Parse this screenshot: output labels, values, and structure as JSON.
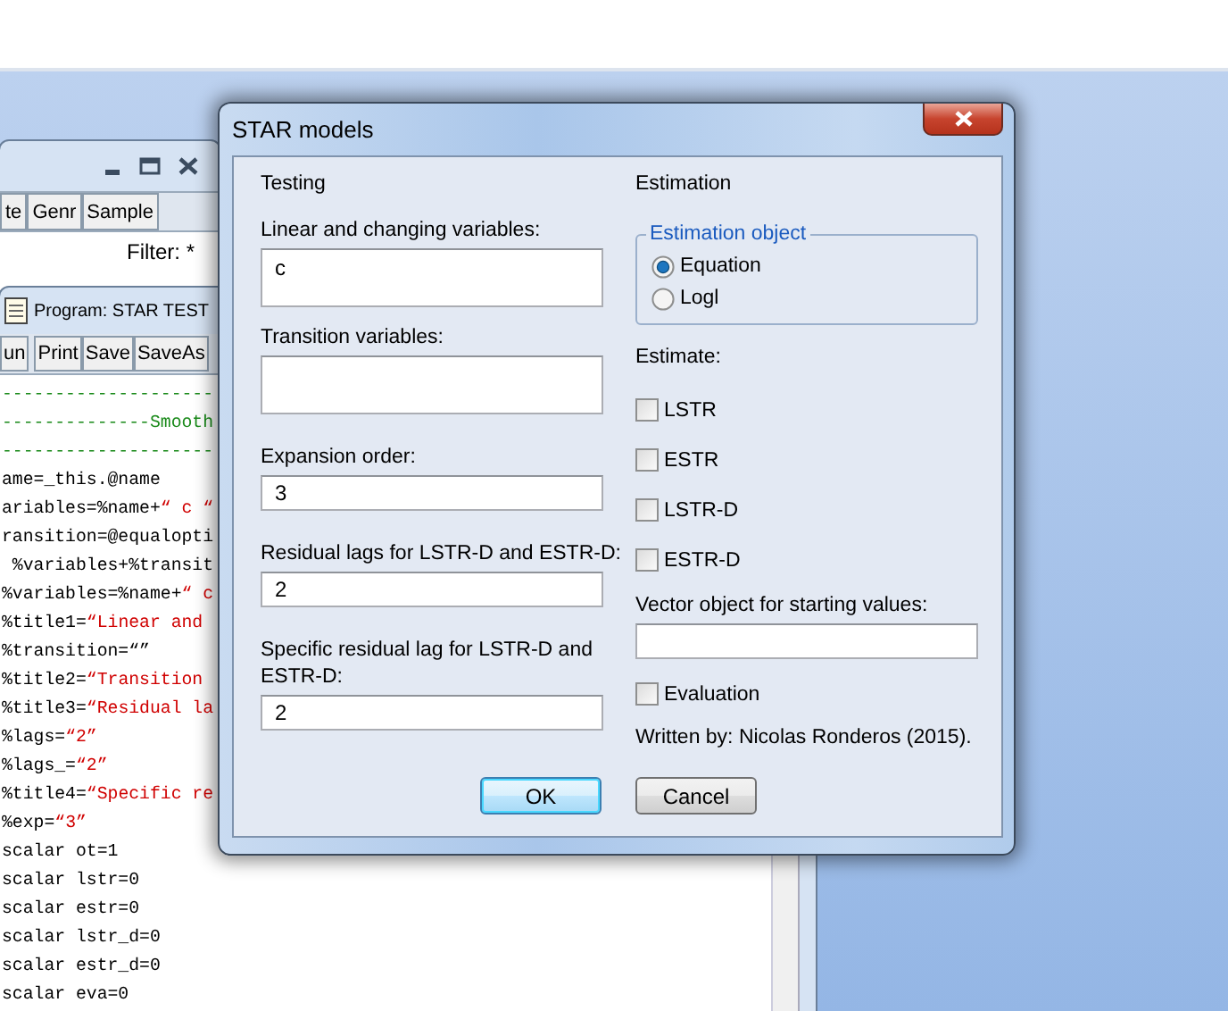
{
  "workfile": {
    "toolbar": [
      "te",
      "Genr",
      "Sample"
    ],
    "filter": "Filter: *"
  },
  "program": {
    "title": "Program: STAR TEST",
    "toolbar": [
      "un",
      "Print",
      "Save",
      "SaveAs"
    ],
    "lines": [
      {
        "parts": [
          {
            "kind": "comment",
            "text": "--------------------"
          }
        ]
      },
      {
        "parts": [
          {
            "kind": "comment",
            "text": "--------------Smooth"
          }
        ]
      },
      {
        "parts": [
          {
            "kind": "comment",
            "text": "--------------------"
          }
        ]
      },
      {
        "parts": [
          {
            "kind": "code",
            "text": "ame=_this.@name"
          }
        ]
      },
      {
        "parts": [
          {
            "kind": "code",
            "text": "ariables=%name+"
          },
          {
            "kind": "string",
            "text": "“ c “"
          }
        ]
      },
      {
        "parts": [
          {
            "kind": "code",
            "text": "ransition=@equalopti"
          }
        ]
      },
      {
        "parts": [
          {
            "kind": "code",
            "text": " %variables+%transit"
          }
        ]
      },
      {
        "parts": [
          {
            "kind": "code",
            "text": "%variables=%name+"
          },
          {
            "kind": "string",
            "text": "“ c"
          }
        ]
      },
      {
        "parts": [
          {
            "kind": "code",
            "text": "%title1="
          },
          {
            "kind": "string",
            "text": "“Linear and"
          }
        ]
      },
      {
        "parts": [
          {
            "kind": "code",
            "text": "%transition=“”"
          }
        ]
      },
      {
        "parts": [
          {
            "kind": "code",
            "text": "%title2="
          },
          {
            "kind": "string",
            "text": "“Transition"
          }
        ]
      },
      {
        "parts": [
          {
            "kind": "code",
            "text": "%title3="
          },
          {
            "kind": "string",
            "text": "“Residual la"
          }
        ]
      },
      {
        "parts": [
          {
            "kind": "code",
            "text": "%lags="
          },
          {
            "kind": "string",
            "text": "“2”"
          }
        ]
      },
      {
        "parts": [
          {
            "kind": "code",
            "text": "%lags_="
          },
          {
            "kind": "string",
            "text": "“2”"
          }
        ]
      },
      {
        "parts": [
          {
            "kind": "code",
            "text": "%title4="
          },
          {
            "kind": "string",
            "text": "“Specific re"
          }
        ]
      },
      {
        "parts": [
          {
            "kind": "code",
            "text": "%exp="
          },
          {
            "kind": "string",
            "text": "“3”"
          }
        ]
      },
      {
        "parts": [
          {
            "kind": "code",
            "text": "scalar ot=1"
          }
        ]
      },
      {
        "parts": [
          {
            "kind": "code",
            "text": "scalar lstr=0"
          }
        ]
      },
      {
        "parts": [
          {
            "kind": "code",
            "text": "scalar estr=0"
          }
        ]
      },
      {
        "parts": [
          {
            "kind": "code",
            "text": "scalar lstr_d=0"
          }
        ]
      },
      {
        "parts": [
          {
            "kind": "code",
            "text": "scalar estr_d=0"
          }
        ]
      },
      {
        "parts": [
          {
            "kind": "code",
            "text": "scalar eva=0"
          }
        ]
      }
    ]
  },
  "dialog": {
    "title": "STAR models",
    "testing": {
      "heading": "Testing",
      "fields": [
        {
          "label": "Linear and changing variables:",
          "value": "c",
          "kind": "tall"
        },
        {
          "label": "Transition variables:",
          "kind": "tall"
        },
        {
          "label": "Expansion order:",
          "value": "3",
          "kind": "short"
        },
        {
          "label": "Residual lags for LSTR-D and ESTR-D:",
          "value": "2",
          "kind": "short"
        },
        {
          "label": "Specific residual lag for LSTR-D and ESTR-D:",
          "value": "2",
          "kind": "short"
        }
      ]
    },
    "estimation": {
      "heading": "Estimation",
      "group": {
        "legend": "Estimation object",
        "options": [
          {
            "label": "Equation",
            "selected": true
          },
          {
            "label": "Logl",
            "selected": false
          }
        ]
      },
      "estimate_label": "Estimate:",
      "models": [
        {
          "label": "LSTR",
          "checked": false
        },
        {
          "label": "ESTR",
          "checked": false
        },
        {
          "label": "LSTR-D",
          "checked": false
        },
        {
          "label": "ESTR-D",
          "checked": false
        }
      ],
      "vector_label": "Vector object for starting values:",
      "evaluation": {
        "label": "Evaluation",
        "checked": false
      },
      "credit": "Written by: Nicolas Ronderos (2015)."
    },
    "buttons": [
      {
        "label": "OK",
        "default": true
      },
      {
        "label": "Cancel",
        "default": false
      }
    ]
  }
}
